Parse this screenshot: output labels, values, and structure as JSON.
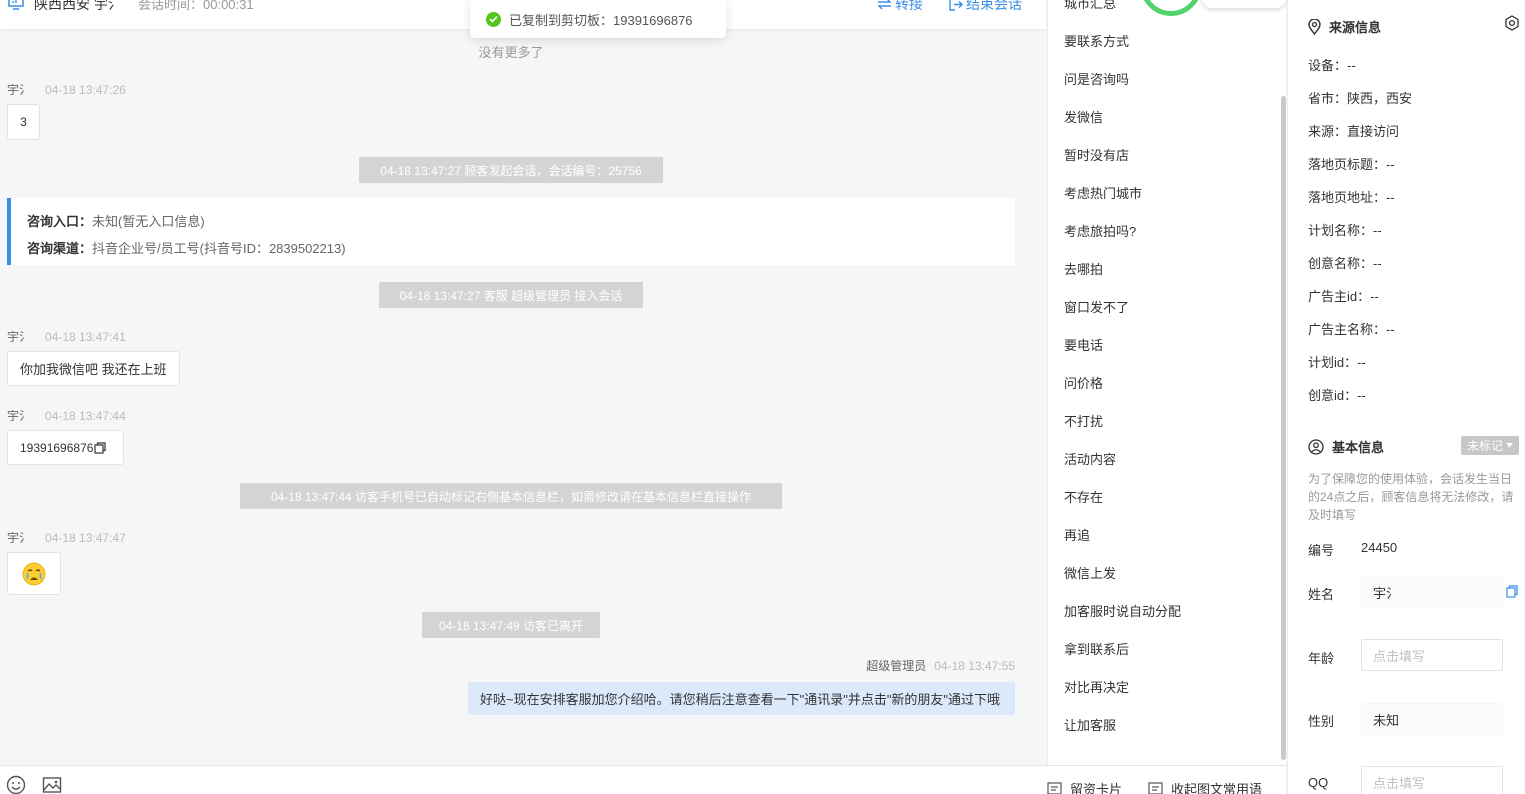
{
  "header": {
    "visitor_title": "陕西西安   宇氵",
    "session_time": "会话时间：00:00:31",
    "transfer_label": "转接",
    "end_label": "结束会话"
  },
  "toast": {
    "text": "已复制到剪切板：19391696876"
  },
  "chat": {
    "no_more": "没有更多了",
    "msg1": {
      "who": "宇氵",
      "time": "04-18 13:47:26",
      "text": "3"
    },
    "sys1": "04-18 13:47:27 顾客发起会话，会话编号：25756",
    "info_card": {
      "entry_label": "咨询入口：",
      "entry_value": "未知(暂无入口信息)",
      "channel_label": "咨询渠道：",
      "channel_value": "抖音企业号/员工号(抖音号ID：2839502213)"
    },
    "sys2": "04-18 13:47:27 客服 超级管理员 接入会话",
    "msg2": {
      "who": "宇氵",
      "time": "04-18 13:47:41",
      "text": "你加我微信吧 我还在上班"
    },
    "msg3": {
      "who": "宇氵",
      "time": "04-18 13:47:44",
      "text": "19391696876"
    },
    "sys3": "04-18 13:47:44 访客手机号已自动标记右侧基本信息栏，如需修改请在基本信息栏直接操作",
    "msg4": {
      "who": "宇氵",
      "time": "04-18 13:47:47",
      "text": "😭"
    },
    "sys4": "04-18 13:47:49 访客已离开",
    "agent": {
      "who": "超级管理员",
      "time": "04-18 13:47:55",
      "text": "好哒~现在安排客服加您介绍哈。请您稍后注意查看一下\"通讯录\"并点击\"新的朋友\"通过下哦"
    }
  },
  "footer": {
    "card_label": "留资卡片",
    "common_label": "收起图文常用语"
  },
  "quick_replies": [
    "城市汇总",
    "要联系方式",
    "问是咨询吗",
    "发微信",
    "暂时没有店",
    "考虑热门城市",
    "考虑旅拍吗?",
    "去哪拍",
    "窗口发不了",
    "要电话",
    "问价格",
    "不打扰",
    "活动内容",
    "不存在",
    "再追",
    "微信上发",
    "加客服时说自动分配",
    "拿到联系后",
    "对比再决定",
    "让加客服"
  ],
  "source_info": {
    "title": "来源信息",
    "rows": [
      "设备：--",
      "省市：陕西，西安",
      "来源：直接访问",
      "落地页标题：--",
      "落地页地址：--",
      "计划名称：--",
      "创意名称：--",
      "广告主id：--",
      "广告主名称：--",
      "计划id：--",
      "创意id：--"
    ]
  },
  "basic_info": {
    "title": "基本信息",
    "tag_label": "未标记",
    "hint": "为了保障您的使用体验，会话发生当日的24点之后，顾客信息将无法修改，请及时填写",
    "id_label": "编号",
    "id_value": "24450",
    "name_label": "姓名",
    "name_value": "宇氵",
    "age_label": "年龄",
    "age_placeholder": "点击填写",
    "gender_label": "性别",
    "gender_value": "未知",
    "qq_label": "QQ",
    "qq_placeholder": "点击填写"
  },
  "colors": {
    "accent": "#3a8ee6",
    "success": "#52c41a",
    "system_bubble": "#d4d4d4",
    "agent_bubble": "#dbe9fb"
  }
}
